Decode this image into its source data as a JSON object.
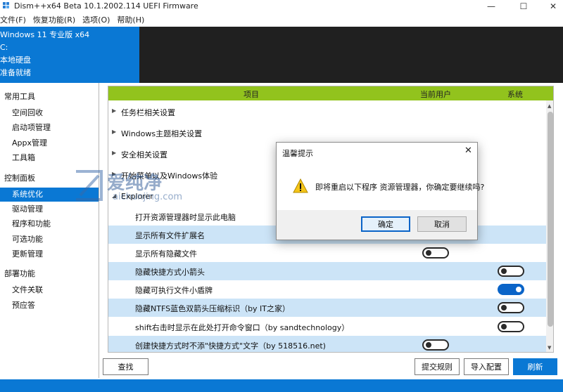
{
  "window": {
    "title": "Dism++x64 Beta 10.1.2002.114 UEFI Firmware",
    "minimize": "—",
    "maximize": "☐",
    "close": "✕"
  },
  "menu": [
    "文件(F)",
    "恢复功能(R)",
    "选项(O)",
    "帮助(H)"
  ],
  "info": {
    "os": "Windows 11 专业版 x64",
    "drive": "C:",
    "disk": "本地硬盘",
    "status": "准备就绪"
  },
  "sidebar": {
    "groups": [
      "常用工具",
      "控制面板",
      "部署功能"
    ],
    "common": [
      "空间回收",
      "启动项管理",
      "Appx管理",
      "工具箱"
    ],
    "control": [
      "系统优化",
      "驱动管理",
      "程序和功能",
      "可选功能",
      "更新管理"
    ],
    "deploy": [
      "文件关联",
      "预应答"
    ]
  },
  "table": {
    "headers": [
      "项目",
      "当前用户",
      "系统"
    ],
    "sections": [
      "任务栏相关设置",
      "Windows主题相关设置",
      "安全相关设置",
      "开始菜单以及Windows体验",
      "Explorer"
    ],
    "items": [
      {
        "label": "打开资源管理器时显示此电脑",
        "user": null,
        "system": null
      },
      {
        "label": "显示所有文件扩展名",
        "user": null,
        "system": null
      },
      {
        "label": "显示所有隐藏文件",
        "user": "off",
        "system": null
      },
      {
        "label": "隐藏快捷方式小箭头",
        "user": null,
        "system": "off"
      },
      {
        "label": "隐藏可执行文件小盾牌",
        "user": null,
        "system": "on"
      },
      {
        "label": "隐藏NTFS蓝色双箭头压缩标识（by IT之家）",
        "user": null,
        "system": "off"
      },
      {
        "label": "shift右击时显示在此处打开命令窗口（by sandtechnology）",
        "user": null,
        "system": "off"
      },
      {
        "label": "创建快捷方式时不添\"快捷方式\"文字（by 518516.net)",
        "user": "off",
        "system": null
      }
    ]
  },
  "buttons": {
    "search": "查找",
    "submit_rule": "提交规则",
    "import_config": "导入配置",
    "refresh": "刷新"
  },
  "dialog": {
    "title": "温馨提示",
    "close": "✕",
    "message": "即将重启以下程序 资源管理器，你确定要继续吗?",
    "ok": "确定",
    "cancel": "取消"
  },
  "watermark": {
    "text": "爱纯净",
    "url": "aichunjing.com"
  },
  "colors": {
    "accent": "#0a78d4",
    "header_green": "#92c31d",
    "row_highlight": "#cce4f7",
    "toggle_on": "#0a64c8"
  }
}
